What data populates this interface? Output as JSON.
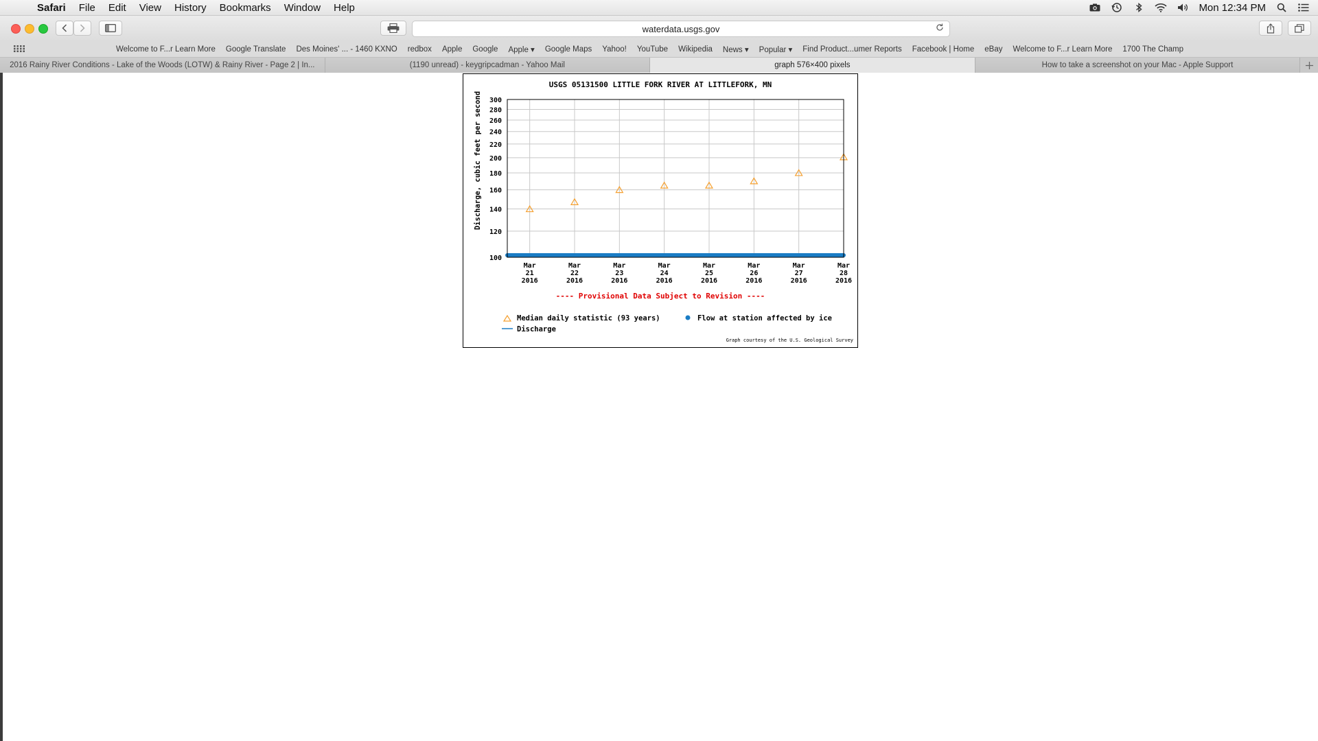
{
  "menubar": {
    "apple_glyph": "",
    "app": "Safari",
    "items": [
      "File",
      "Edit",
      "View",
      "History",
      "Bookmarks",
      "Window",
      "Help"
    ],
    "clock": "Mon 12:34 PM",
    "status_icons": [
      "screenshot-icon",
      "time-machine-icon",
      "bluetooth-icon",
      "wifi-icon",
      "volume-icon",
      "spotlight-icon",
      "notification-center-icon"
    ]
  },
  "toolbar": {
    "url": "waterdata.usgs.gov"
  },
  "favorites": [
    "Welcome to F...r Learn More",
    "Google Translate",
    "Des Moines' ... - 1460 KXNO",
    "redbox",
    "Apple",
    "Google",
    "Apple ▾",
    "Google Maps",
    "Yahoo!",
    "YouTube",
    "Wikipedia",
    "News ▾",
    "Popular ▾",
    "Find Product...umer Reports",
    "Facebook | Home",
    "eBay",
    "Welcome to F...r Learn More",
    "1700 The Champ"
  ],
  "tabs": [
    {
      "label": "2016 Rainy River Conditions - Lake of the Woods (LOTW) & Rainy River - Page 2 | In...",
      "active": false
    },
    {
      "label": "(1190 unread) - keygripcadman - Yahoo Mail",
      "active": false
    },
    {
      "label": "graph 576×400 pixels",
      "active": true
    },
    {
      "label": "How to take a screenshot on your Mac - Apple Support",
      "active": false
    }
  ],
  "chart_data": {
    "type": "scatter",
    "title": "USGS 05131500 LITTLE FORK RIVER AT LITTLEFORK, MN",
    "ylabel": "Discharge, cubic feet per second",
    "xlabel": "",
    "yscale": "log",
    "ylim": [
      100,
      300
    ],
    "yticks": [
      100,
      120,
      140,
      160,
      180,
      200,
      220,
      240,
      260,
      280,
      300
    ],
    "grid": true,
    "categories": [
      {
        "month": "Mar",
        "day": "21",
        "year": "2016"
      },
      {
        "month": "Mar",
        "day": "22",
        "year": "2016"
      },
      {
        "month": "Mar",
        "day": "23",
        "year": "2016"
      },
      {
        "month": "Mar",
        "day": "24",
        "year": "2016"
      },
      {
        "month": "Mar",
        "day": "25",
        "year": "2016"
      },
      {
        "month": "Mar",
        "day": "26",
        "year": "2016"
      },
      {
        "month": "Mar",
        "day": "27",
        "year": "2016"
      },
      {
        "month": "Mar",
        "day": "28",
        "year": "2016"
      }
    ],
    "series": [
      {
        "name": "Median daily statistic (93 years)",
        "marker": "triangle",
        "color": "#f5a030",
        "values": [
          140,
          147,
          160,
          165,
          165,
          170,
          180,
          201
        ]
      },
      {
        "name": "Flow at station affected by ice",
        "marker": "dot",
        "color": "#1a7cc4",
        "x_range": [
          "2016-03-21",
          "2016-03-28"
        ]
      },
      {
        "name": "Discharge",
        "marker": "line",
        "color": "#1a7cc4"
      }
    ],
    "provisional_note": "---- Provisional Data Subject to Revision ----",
    "credit": "Graph courtesy of the U.S. Geological Survey",
    "note_color": "#e00000"
  }
}
